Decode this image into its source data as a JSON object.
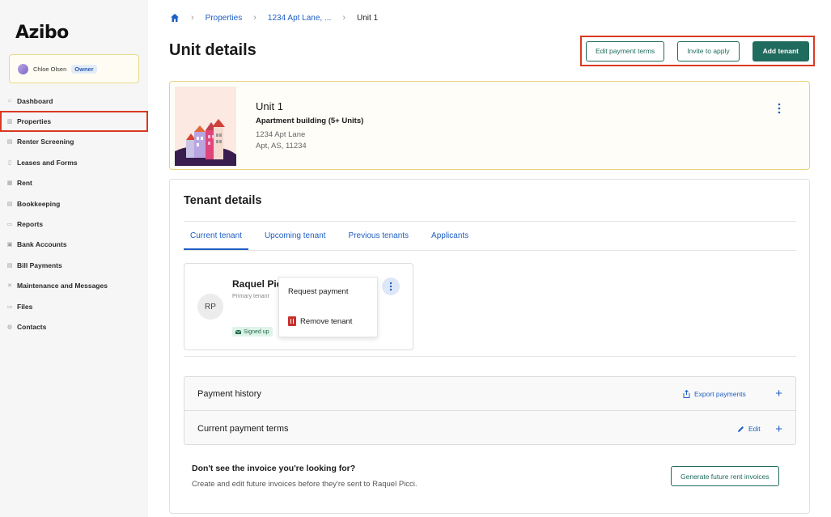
{
  "app": {
    "logo": "Azibo"
  },
  "user": {
    "name": "Chloe Olsen",
    "role": "Owner"
  },
  "sidebar": {
    "items": [
      {
        "label": "Dashboard",
        "icon": "home-icon"
      },
      {
        "label": "Properties",
        "icon": "building-icon"
      },
      {
        "label": "Renter Screening",
        "icon": "screening-icon"
      },
      {
        "label": "Leases and Forms",
        "icon": "document-icon"
      },
      {
        "label": "Rent",
        "icon": "rent-icon"
      },
      {
        "label": "Bookkeeping",
        "icon": "book-icon"
      },
      {
        "label": "Reports",
        "icon": "report-icon"
      },
      {
        "label": "Bank Accounts",
        "icon": "bank-icon"
      },
      {
        "label": "Bill Payments",
        "icon": "bill-icon"
      },
      {
        "label": "Maintenance and Messages",
        "icon": "tools-icon"
      },
      {
        "label": "Files",
        "icon": "folder-icon"
      },
      {
        "label": "Contacts",
        "icon": "contact-icon"
      }
    ]
  },
  "breadcrumb": {
    "properties": "Properties",
    "address": "1234 Apt Lane, ...",
    "current": "Unit 1"
  },
  "page": {
    "title": "Unit details"
  },
  "actions": {
    "edit_terms": "Edit payment terms",
    "invite": "Invite to apply",
    "add_tenant": "Add tenant"
  },
  "unit": {
    "title": "Unit 1",
    "type": "Apartment building (5+ Units)",
    "address_line1": "1234 Apt Lane",
    "address_line2": "Apt, AS, 11234"
  },
  "tenant_details": {
    "title": "Tenant details",
    "tabs": [
      "Current tenant",
      "Upcoming tenant",
      "Previous tenants",
      "Applicants"
    ],
    "tenant": {
      "initials": "RP",
      "name": "Raquel Picci",
      "role": "Primary tenant",
      "status": "Signed up"
    },
    "menu": {
      "request_payment": "Request payment",
      "remove_tenant": "Remove tenant"
    }
  },
  "payment_history": {
    "label": "Payment history",
    "export": "Export payments"
  },
  "payment_terms": {
    "label": "Current payment terms",
    "edit": "Edit"
  },
  "invoice": {
    "title": "Don't see the invoice you're looking for?",
    "subtitle": "Create and edit future invoices before they're sent to Raquel Picci.",
    "button": "Generate future rent invoices"
  },
  "colors": {
    "accent": "#1f5fc4",
    "brand": "#1f6b5d",
    "highlight": "#d93a22"
  }
}
